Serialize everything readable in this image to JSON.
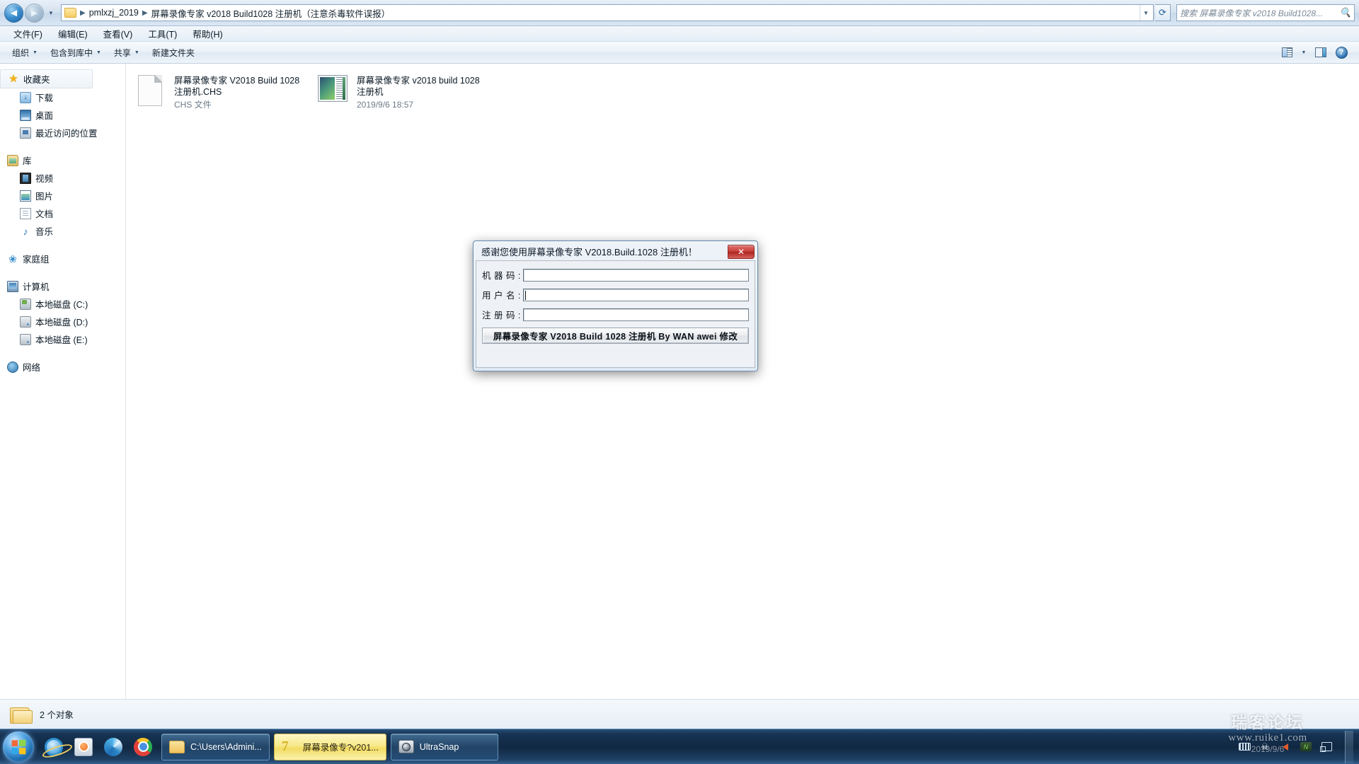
{
  "explorer": {
    "address": {
      "folder_icon": "folder-icon",
      "crumbs": [
        "pmlxzj_2019",
        "屏幕录像专家 v2018 Build1028 注册机（注意杀毒软件误报）"
      ],
      "separator": "▶",
      "dropdown_icon": "chevron-down-icon",
      "refresh_icon": "refresh-icon"
    },
    "nav": {
      "back_icon": "back-arrow-icon",
      "forward_icon": "forward-arrow-icon",
      "history_icon": "chevron-down-icon"
    },
    "search": {
      "placeholder": "搜索 屏幕录像专家 v2018 Build1028...",
      "value": "",
      "icon": "search-icon"
    },
    "menubar": [
      {
        "label": "文件(F)",
        "name": "menu-file"
      },
      {
        "label": "编辑(E)",
        "name": "menu-edit"
      },
      {
        "label": "查看(V)",
        "name": "menu-view"
      },
      {
        "label": "工具(T)",
        "name": "menu-tools"
      },
      {
        "label": "帮助(H)",
        "name": "menu-help"
      }
    ],
    "commandbar": {
      "organize": "组织",
      "include_in_library": "包含到库中",
      "share": "共享",
      "new_folder": "新建文件夹",
      "caret": "▼",
      "view_icon": "view-layout-icon",
      "view_caret": "▼",
      "preview_pane_icon": "preview-pane-icon",
      "help_icon": "help-icon",
      "help_glyph": "?"
    },
    "navpane": {
      "groups": [
        {
          "root": {
            "label": "收藏夹",
            "icon": "star-icon",
            "selected": true
          },
          "items": [
            {
              "label": "下载",
              "icon": "downloads-icon"
            },
            {
              "label": "桌面",
              "icon": "desktop-icon"
            },
            {
              "label": "最近访问的位置",
              "icon": "recent-places-icon"
            }
          ]
        },
        {
          "root": {
            "label": "库",
            "icon": "library-icon",
            "selected": false
          },
          "items": [
            {
              "label": "视频",
              "icon": "video-library-icon"
            },
            {
              "label": "图片",
              "icon": "pictures-library-icon"
            },
            {
              "label": "文档",
              "icon": "documents-library-icon"
            },
            {
              "label": "音乐",
              "icon": "music-library-icon"
            }
          ]
        },
        {
          "root": {
            "label": "家庭组",
            "icon": "homegroup-icon",
            "selected": false
          },
          "items": []
        },
        {
          "root": {
            "label": "计算机",
            "icon": "computer-icon",
            "selected": false
          },
          "items": [
            {
              "label": "本地磁盘 (C:)",
              "icon": "system-drive-icon"
            },
            {
              "label": "本地磁盘 (D:)",
              "icon": "hard-drive-icon"
            },
            {
              "label": "本地磁盘 (E:)",
              "icon": "hard-drive-icon"
            }
          ]
        },
        {
          "root": {
            "label": "网络",
            "icon": "network-icon",
            "selected": false
          },
          "items": []
        }
      ]
    },
    "files": [
      {
        "name": "屏幕录像专家 V2018  Build 1028 注册机.CHS",
        "subtitle": "CHS 文件",
        "icon": "generic-document-icon"
      },
      {
        "name": "屏幕录像专家 v2018  build 1028 注册机",
        "subtitle": "2019/9/6 18:57",
        "icon": "application-window-icon"
      }
    ],
    "statusbar": {
      "icon": "open-folder-icon",
      "text": "2 个对象"
    }
  },
  "dialog": {
    "title": "感谢您使用屏幕录像专家 V2018.Build.1028 注册机！",
    "close_label": "✕",
    "close_icon": "close-icon",
    "fields": [
      {
        "label": "机 器 码 :",
        "value": "",
        "name": "machine-code-field",
        "focused": false
      },
      {
        "label": "用 户 名 :",
        "value": "",
        "name": "username-field",
        "focused": true
      },
      {
        "label": "注 册 码 :",
        "value": "",
        "name": "registration-code-field",
        "focused": false
      }
    ],
    "button_label": "屏幕录像专家 V2018 Build 1028 注册机 By WAN awei 修改"
  },
  "taskbar": {
    "start_label": "开始",
    "start_icon": "windows-start-orb-icon",
    "quicklaunch": [
      {
        "name": "internet-explorer-icon",
        "label": "Internet Explorer"
      },
      {
        "name": "windows-media-player-icon",
        "label": "Windows Media Player"
      },
      {
        "name": "qq-browser-icon",
        "label": "QQ 浏览器"
      },
      {
        "name": "chrome-browser-icon",
        "label": "Chrome"
      }
    ],
    "windows": [
      {
        "label": "C:\\Users\\Admini...",
        "icon": "folder-icon",
        "active": false
      },
      {
        "label": "屏幕录像专?v201...",
        "icon": "pmlxzj-icon",
        "active": true
      },
      {
        "label": "UltraSnap",
        "icon": "camera-icon",
        "active": false
      }
    ],
    "tray": [
      {
        "name": "keyboard-layout-icon"
      },
      {
        "name": "antivirus-icon",
        "glyph": "☠"
      },
      {
        "name": "volume-icon"
      },
      {
        "name": "nvidia-icon"
      },
      {
        "name": "network-icon"
      }
    ],
    "show_desktop": "显示桌面"
  },
  "watermark": {
    "line1": "瑞客论坛",
    "line2": "www.ruike1.com",
    "line3": "2019/9/6"
  },
  "colors": {
    "accent": "#1f6fb4",
    "titlebar_close": "#c93c38",
    "active_task": "#f2dc63",
    "selection": "#cde3f7"
  }
}
